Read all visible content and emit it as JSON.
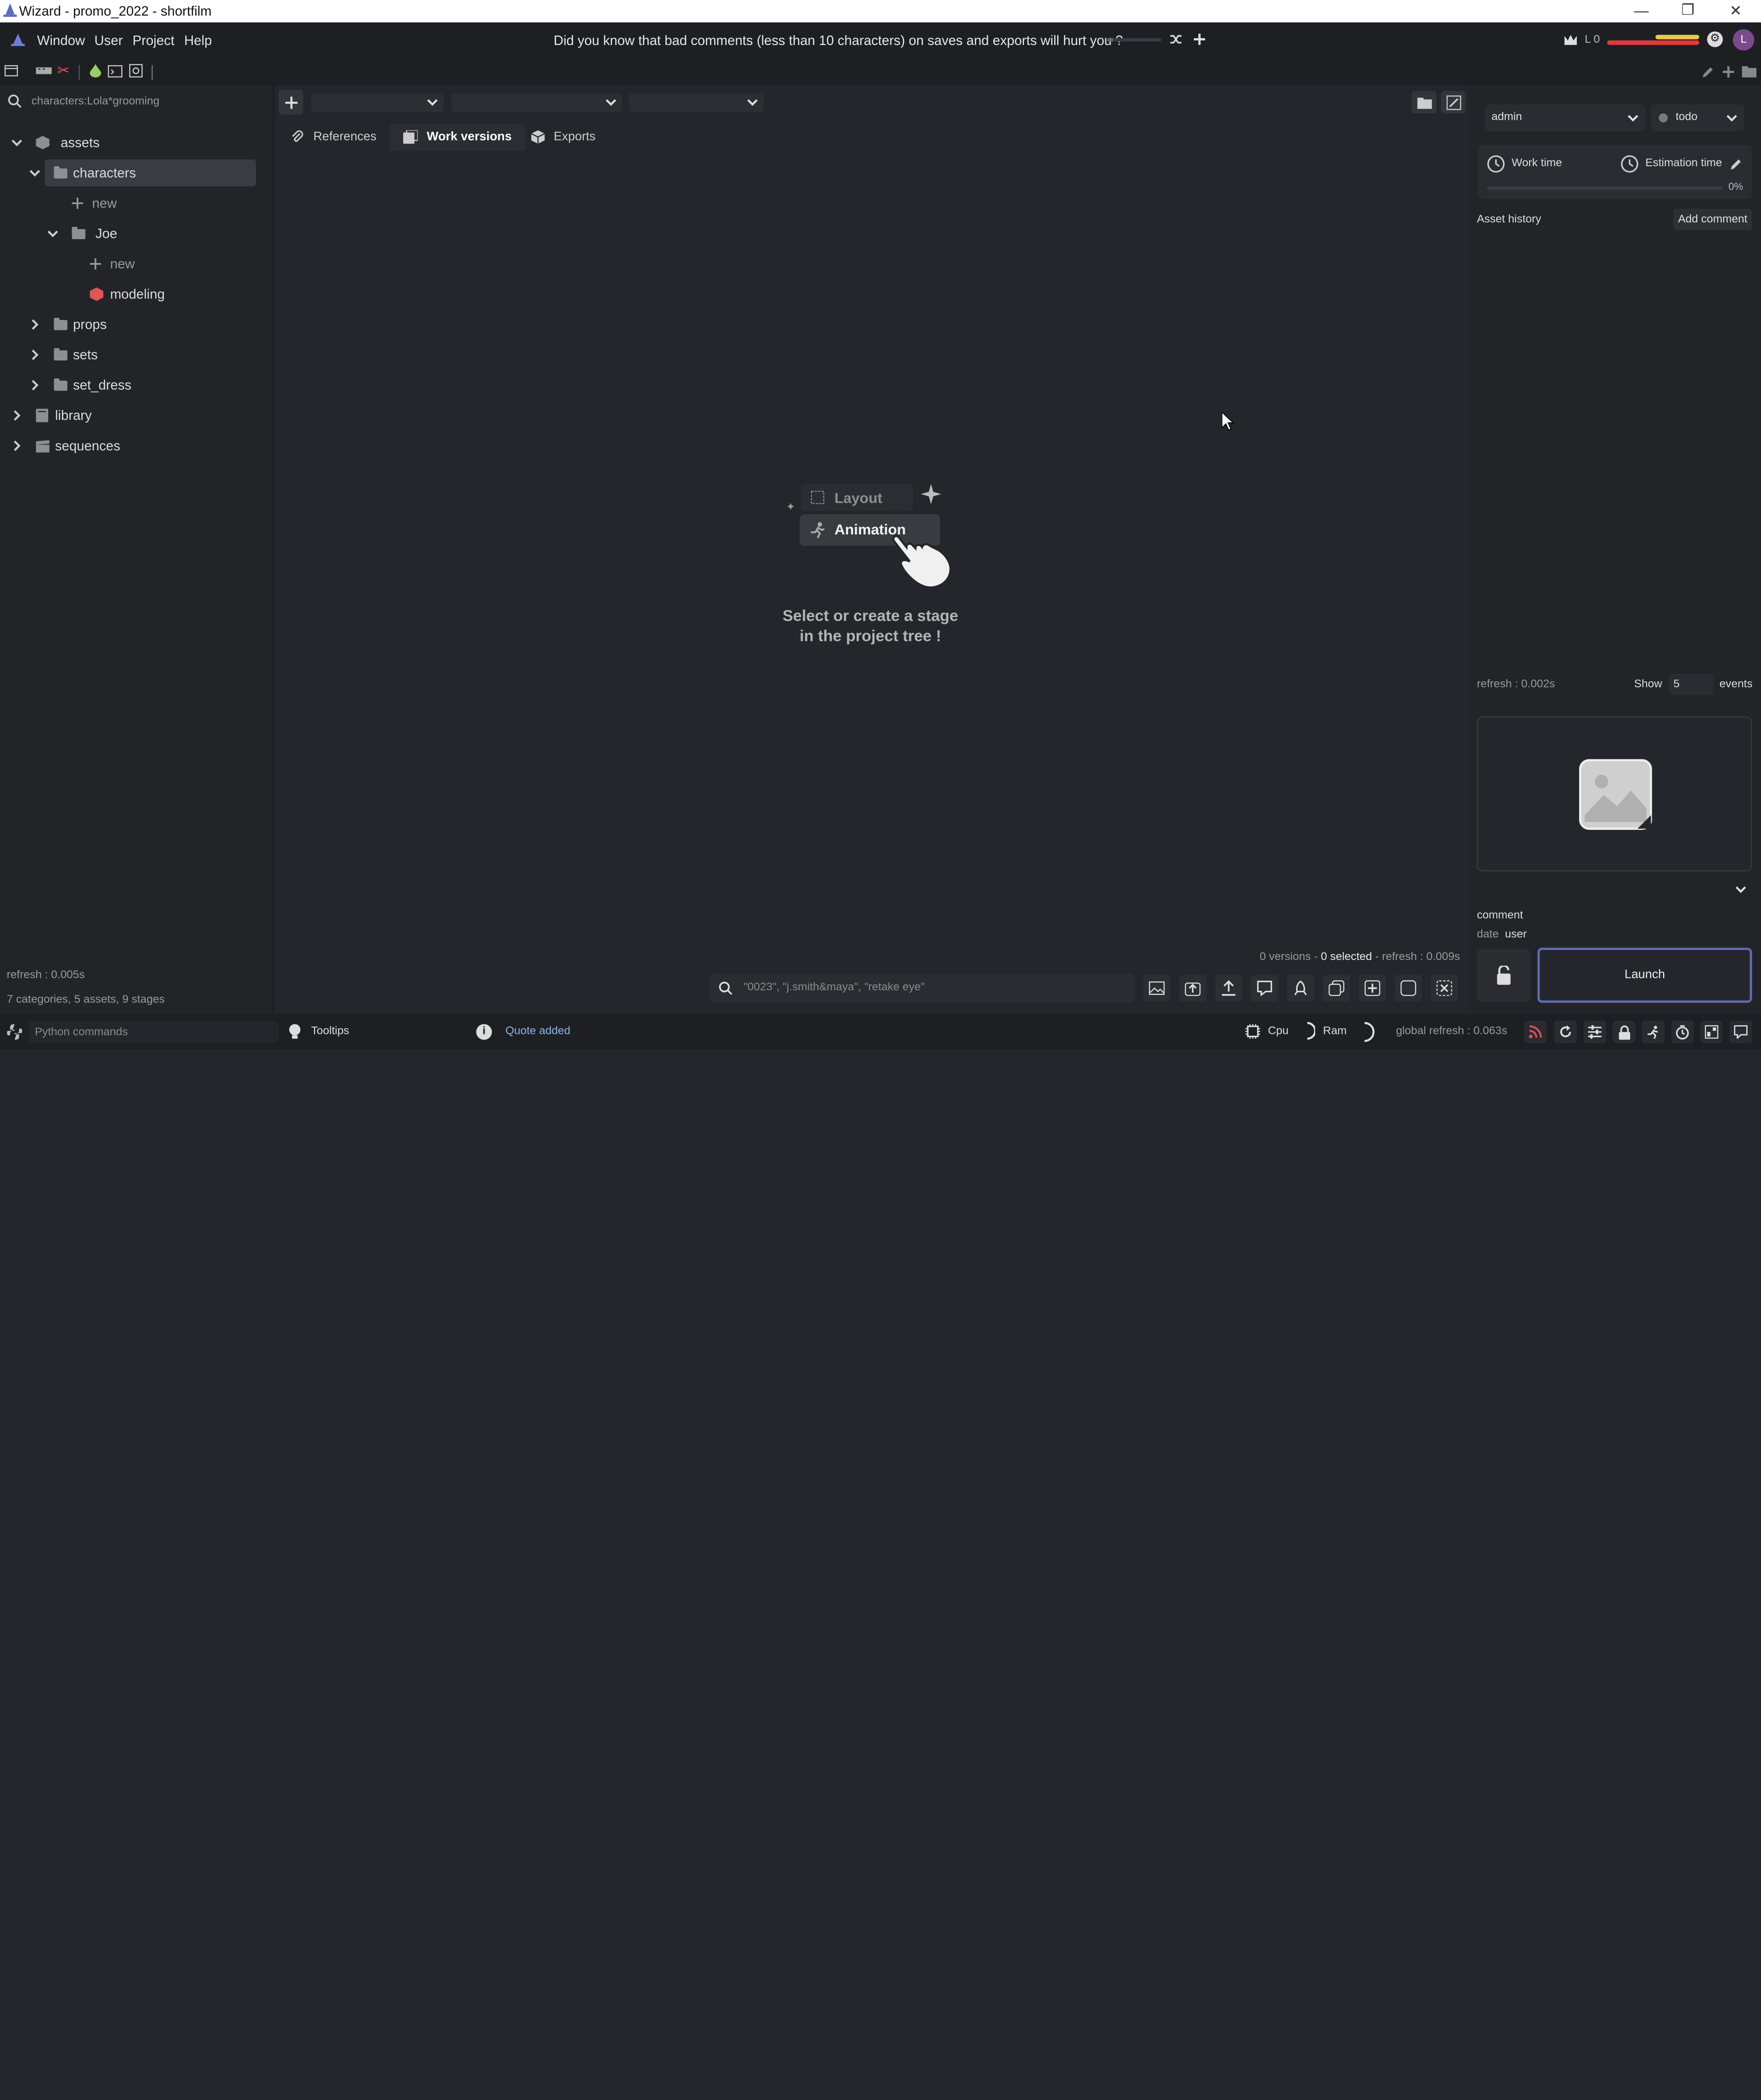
{
  "titlebar": {
    "title": "Wizard - promo_2022 - shortfilm"
  },
  "menu": {
    "items": [
      "Window",
      "User",
      "Project",
      "Help"
    ]
  },
  "tip": {
    "text": "Did you know that bad comments (less than 10 characters) on saves and exports will hurt you ?"
  },
  "user": {
    "level": "L 0",
    "initial": "L"
  },
  "search": {
    "value": "characters:Lola*grooming"
  },
  "tree": {
    "assets": "assets",
    "characters": "characters",
    "new1": "new",
    "joe": "Joe",
    "new2": "new",
    "modeling": "modeling",
    "props": "props",
    "sets": "sets",
    "set_dress": "set_dress",
    "library": "library",
    "sequences": "sequences"
  },
  "left_footer": {
    "refresh": "refresh : 0.005s",
    "summary": "7 categories, 5 assets, 9 stages"
  },
  "tabs": {
    "references": "References",
    "work_versions": "Work versions",
    "exports": "Exports"
  },
  "empty": {
    "layout": "Layout",
    "animation": "Animation",
    "line1": "Select or create a stage",
    "line2": "in the project tree !"
  },
  "versions": {
    "count": "0 versions -",
    "selected": "0 selected",
    "refresh": "- refresh : 0.009s"
  },
  "version_search": {
    "placeholder": "\"0023\", \"j.smith&maya\", \"retake eye\""
  },
  "right": {
    "user": "admin",
    "status": "todo",
    "work_time": "Work time",
    "estimation_time": "Estimation time",
    "percent": "0%",
    "history": "Asset history",
    "add_comment": "Add comment",
    "refresh": "refresh : 0.002s",
    "show": "Show",
    "events_count": "5",
    "events": "events",
    "comment": "comment",
    "date": "date",
    "user_label": "user",
    "launch": "Launch"
  },
  "status": {
    "python": "Python commands",
    "tooltips": "Tooltips",
    "quote": "Quote added",
    "cpu": "Cpu",
    "ram": "Ram",
    "global_refresh": "global refresh : 0.063s"
  },
  "colors": {
    "accent": "#5f6db6",
    "link": "#8db4e8",
    "modeling": "#e05555",
    "bg": "#25262b"
  }
}
